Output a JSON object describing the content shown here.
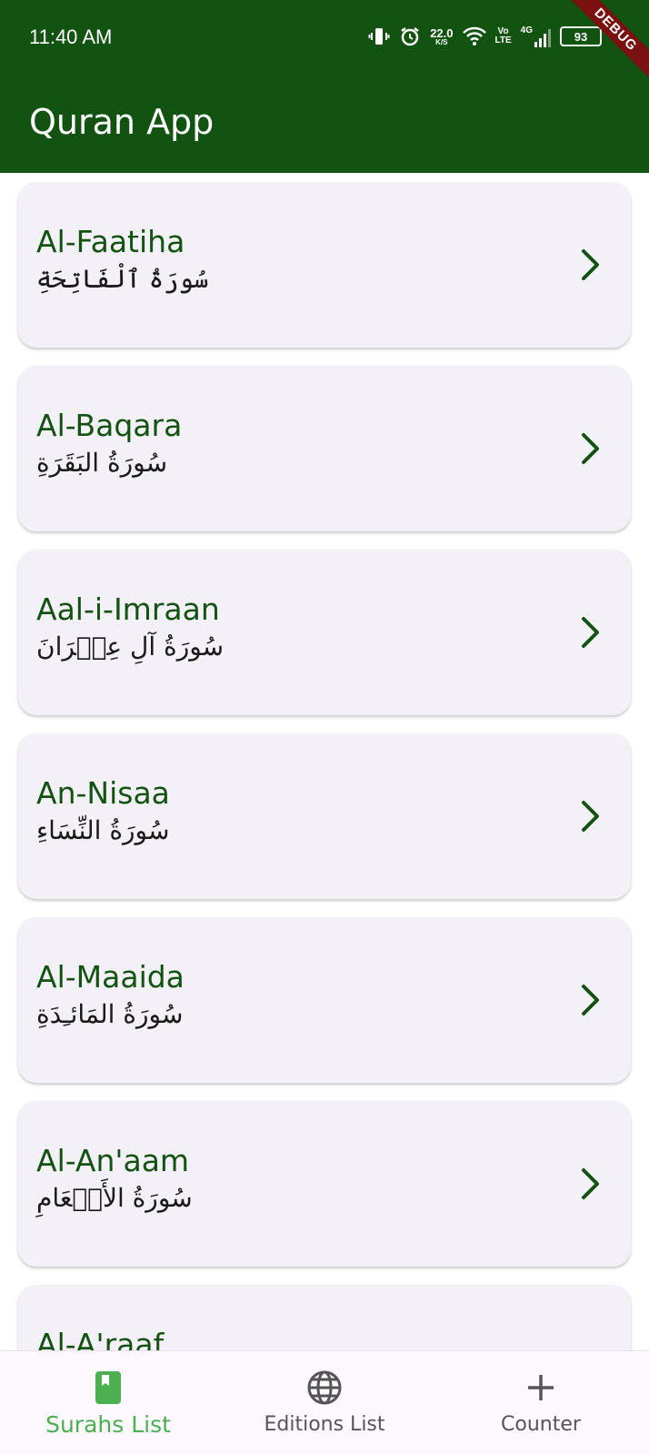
{
  "status_bar": {
    "time": "11:40 AM",
    "net_speed_value": "22.0",
    "net_speed_unit": "K/S",
    "volte_top": "Vo",
    "volte_bottom": "LTE",
    "network_type": "4G",
    "battery": "93",
    "debug_banner": "DEBUG"
  },
  "app_bar": {
    "title": "Quran App"
  },
  "surahs": [
    {
      "name": "Al-Faatiha",
      "arabic": "سُورَةُ ٱلْفَاتِحَةِ"
    },
    {
      "name": "Al-Baqara",
      "arabic": "سُورَةُ البَقَرَةِ"
    },
    {
      "name": "Aal-i-Imraan",
      "arabic": "سُورَةُ آلِ عِمۡرَانَ"
    },
    {
      "name": "An-Nisaa",
      "arabic": "سُورَةُ النِّسَاءِ"
    },
    {
      "name": "Al-Maaida",
      "arabic": "سُورَةُ المَائـِدَةِ"
    },
    {
      "name": "Al-An'aam",
      "arabic": "سُورَةُ الأَنۡعَامِ"
    },
    {
      "name": "Al-A'raaf",
      "arabic": ""
    }
  ],
  "bottom_nav": {
    "items": [
      {
        "label": "Surahs List",
        "icon": "book-icon",
        "active": true
      },
      {
        "label": "Editions List",
        "icon": "globe-icon",
        "active": false
      },
      {
        "label": "Counter",
        "icon": "plus-icon",
        "active": false
      }
    ]
  },
  "colors": {
    "primary": "#125312",
    "active_nav": "#4caf50",
    "card_bg": "#f4f0f7"
  }
}
